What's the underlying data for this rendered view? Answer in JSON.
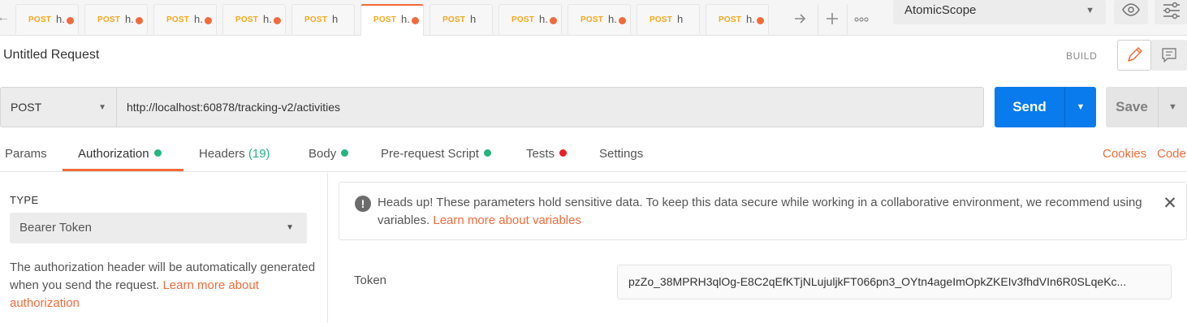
{
  "tabs": [
    {
      "method": "POST",
      "name": "h.",
      "unsaved": true,
      "active": false
    },
    {
      "method": "POST",
      "name": "h.",
      "unsaved": true,
      "active": false
    },
    {
      "method": "POST",
      "name": "h.",
      "unsaved": true,
      "active": false
    },
    {
      "method": "POST",
      "name": "h.",
      "unsaved": true,
      "active": false
    },
    {
      "method": "POST",
      "name": "h",
      "unsaved": false,
      "active": false
    },
    {
      "method": "POST",
      "name": "h.",
      "unsaved": true,
      "active": true
    },
    {
      "method": "POST",
      "name": "h",
      "unsaved": false,
      "active": false
    },
    {
      "method": "POST",
      "name": "h.",
      "unsaved": true,
      "active": false
    },
    {
      "method": "POST",
      "name": "h.",
      "unsaved": true,
      "active": false
    },
    {
      "method": "POST",
      "name": "h",
      "unsaved": false,
      "active": false
    },
    {
      "method": "POST",
      "name": "h.",
      "unsaved": true,
      "active": false
    }
  ],
  "tab_controls": {
    "forward_icon": "arrow-right-icon",
    "add_icon": "plus-icon",
    "more_icon": "ellipsis-icon"
  },
  "workspace": {
    "name": "AtomicScope"
  },
  "request": {
    "title": "Untitled Request",
    "build_label": "BUILD",
    "method": "POST",
    "url": "http://localhost:60878/tracking-v2/activities",
    "send_label": "Send",
    "save_label": "Save"
  },
  "request_tabs": {
    "params": "Params",
    "authorization": "Authorization",
    "headers": "Headers",
    "headers_count": "(19)",
    "body": "Body",
    "prerequest": "Pre-request Script",
    "tests": "Tests",
    "settings": "Settings",
    "cookies": "Cookies",
    "code": "Code"
  },
  "auth": {
    "type_label": "TYPE",
    "type_value": "Bearer Token",
    "help_text": "The authorization header will be automatically generated when you send the request. ",
    "help_link": "Learn more about authorization"
  },
  "alert": {
    "text": "Heads up! These parameters hold sensitive data. To keep this data secure while working in a collaborative environment, we recommend using variables. ",
    "link": "Learn more about variables"
  },
  "token": {
    "label": "Token",
    "value": "pzZo_38MPRH3qlOg-E8C2qEfKTjNLujuljkFT066pn3_OYtn4ageImOpkZKEIv3fhdVIn6R0SLqeKc..."
  },
  "colors": {
    "accent": "#f26b3a",
    "primary": "#097bed",
    "success": "#26b47f",
    "danger": "#ed1c24",
    "method_post": "#f7a81b"
  }
}
